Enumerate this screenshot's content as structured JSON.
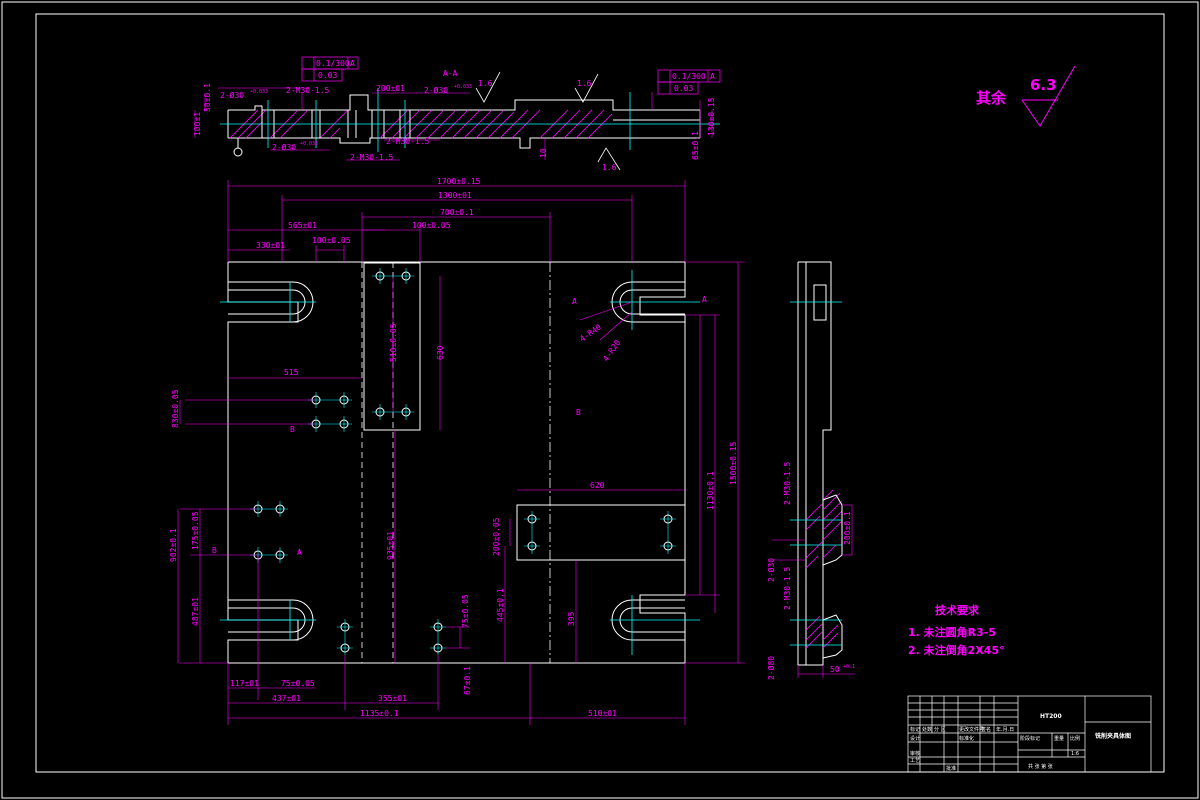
{
  "colors": {
    "background": "#000000",
    "outline": "#ffffff",
    "dimension": "#ff00ff",
    "centerline": "#00ffff",
    "hatch": "#ff00ff"
  },
  "roughness": {
    "remaining_label": "其余",
    "remaining_value": "6.3",
    "marks": [
      "1.6",
      "1.6",
      "1.6"
    ]
  },
  "section_marks": {
    "a_top": "A-A",
    "label_a": "A",
    "label_b": "B"
  },
  "gdt": {
    "left": {
      "parallel": "0.1/300",
      "datum": "A",
      "flatness": "0.03"
    },
    "right": {
      "parallel": "0.1/300",
      "datum": "A",
      "flatness": "0.03"
    }
  },
  "top_view_dims": {
    "d1": "2-Ø30",
    "d1_tol": "+0.033",
    "d2": "2-M30-1.5",
    "d3": "200±01",
    "d4": "2-Ø30",
    "d4_tol": "+0.033",
    "d5": "2-Ø30",
    "d5_tol": "+0.033",
    "d6": "2-M30-1.5",
    "d7": "2-M30-1.5",
    "v1": "50±0.1",
    "v2": "100±1",
    "v3": "10",
    "v4": "130±0.15",
    "v5": "65±0.1"
  },
  "plan_view_dims": {
    "w1700": "1700±0.15",
    "w1300": "1300±01",
    "w700": "700±0.1",
    "w565": "565±01",
    "w100a": "100±0.05",
    "w100b": "100±0.05",
    "w330": "330±01",
    "w515": "515",
    "v510": "510±0.05",
    "v630": "630",
    "v830": "830±0.05",
    "h4r40": "4-R40",
    "h4r20": "4-R20",
    "label_b": "B",
    "label_a": "A",
    "v1130": "1130±0.1",
    "v1500": "1500±0.15",
    "w620": "620",
    "v200": "200±0.05",
    "v935": "935±01",
    "v902": "902±0.1",
    "v175": "175±0.05",
    "v487": "487±01",
    "v75": "75±0.05",
    "v445": "445±0.1",
    "v395": "395",
    "v67": "67±0.1",
    "w117": "117±01",
    "w75": "75±0.05",
    "w437": "437±01",
    "w355": "355±01",
    "w1135": "1135±0.1",
    "w510": "510±01"
  },
  "side_view_dims": {
    "m1": "2-M30-1.5",
    "d1": "2-Ø30",
    "m2": "2-M30-1.5",
    "d2": "2-Ø80",
    "v200": "200±0.1",
    "w50": "50",
    "w50_tol": "+0.1"
  },
  "tech_requirements": {
    "title": "技术要求",
    "items": [
      "1. 未注圆角R3-5",
      "2. 未注倒角2X45°"
    ]
  },
  "title_block": {
    "material": "HT200",
    "drawing_name": "铣削夹具体图",
    "cells": [
      "标记",
      "处数",
      "分 区",
      "更改文件号",
      "签名",
      "年.月.日",
      "设计",
      "标准化",
      "阶段标记",
      "重量",
      "比例",
      "审核",
      "工艺",
      "批准",
      "共 张 第 张"
    ],
    "scale": "1:6"
  }
}
